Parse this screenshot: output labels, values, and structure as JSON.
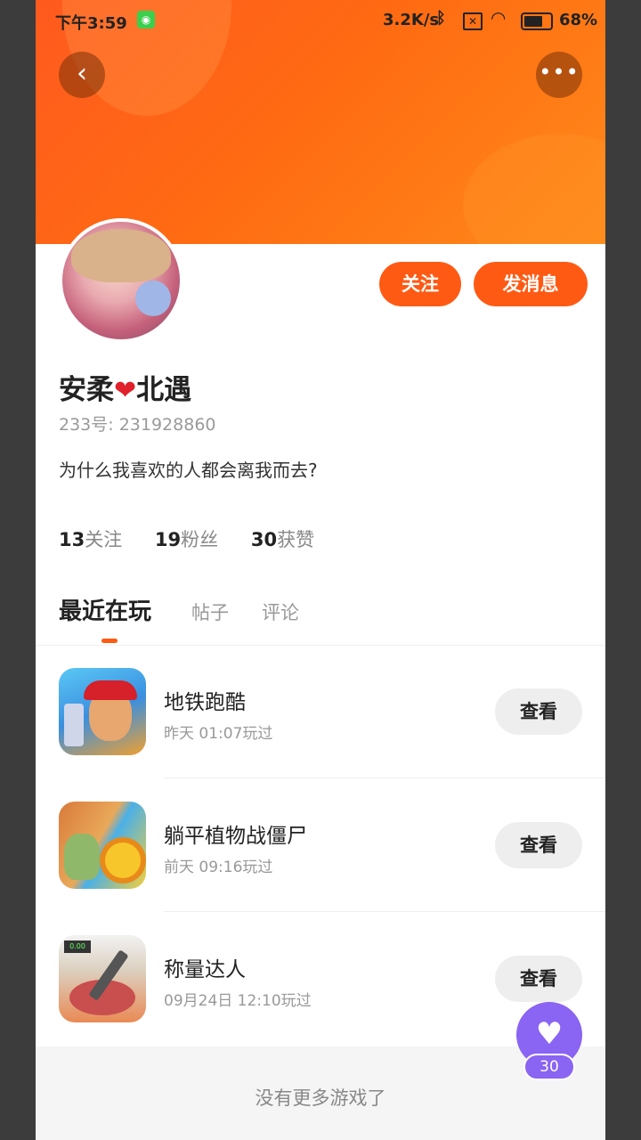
{
  "status_bar": {
    "time": "下午3:59",
    "network_speed": "3.2K/s",
    "battery": "68%",
    "battery_level": 0.68
  },
  "header": {
    "back_icon": "chevron-left-icon",
    "more_icon": "more-dots-icon"
  },
  "profile": {
    "name_part1": "安柔",
    "name_heart": "❤",
    "name_part2": "北遇",
    "uid": "233号: 231928860",
    "bio": "为什么我喜欢的人都会离我而去?",
    "follow_label": "关注",
    "message_label": "发消息"
  },
  "stats": [
    {
      "num": "13",
      "label": "关注"
    },
    {
      "num": "19",
      "label": "粉丝"
    },
    {
      "num": "30",
      "label": "获赞"
    }
  ],
  "tabs": [
    {
      "label": "最近在玩",
      "active": true
    },
    {
      "label": "帖子",
      "active": false
    },
    {
      "label": "评论",
      "active": false
    }
  ],
  "games": [
    {
      "name": "地铁跑酷",
      "time": "昨天 01:07玩过",
      "button": "查看"
    },
    {
      "name": "躺平植物战僵尸",
      "time": "前天 09:16玩过",
      "button": "查看"
    },
    {
      "name": "称量达人",
      "time": "09月24日 12:10玩过",
      "button": "查看"
    }
  ],
  "footer": {
    "message": "没有更多游戏了"
  },
  "fab": {
    "icon": "heart-icon",
    "count": "30"
  },
  "colors": {
    "accent": "#ff5a14",
    "fab": "#8a64f2"
  }
}
